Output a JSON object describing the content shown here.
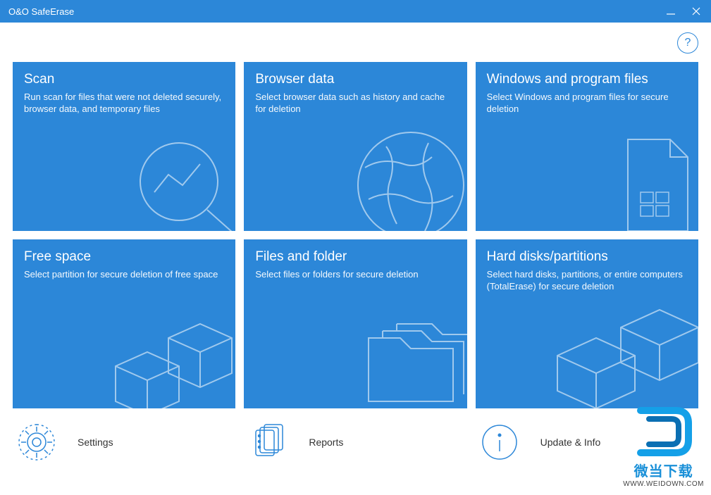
{
  "app": {
    "title": "O&O SafeErase"
  },
  "help": {
    "symbol": "?"
  },
  "cards": [
    {
      "title": "Scan",
      "desc": "Run scan for files that were not deleted securely, browser data, and temporary files"
    },
    {
      "title": "Browser data",
      "desc": "Select browser data such as history and cache for deletion"
    },
    {
      "title": "Windows and program files",
      "desc": "Select Windows and program files for secure deletion"
    },
    {
      "title": "Free space",
      "desc": "Select partition for secure deletion of free space"
    },
    {
      "title": "Files and folder",
      "desc": "Select files or folders for secure deletion"
    },
    {
      "title": "Hard disks/partitions",
      "desc": "Select hard disks, partitions, or entire computers (TotalErase) for secure deletion"
    }
  ],
  "bottom": [
    {
      "label": "Settings"
    },
    {
      "label": "Reports"
    },
    {
      "label": "Update & Info"
    }
  ],
  "watermark": {
    "line1": "微当下载",
    "line2": "WWW.WEIDOWN.COM"
  },
  "colors": {
    "primary": "#2c87d8"
  }
}
